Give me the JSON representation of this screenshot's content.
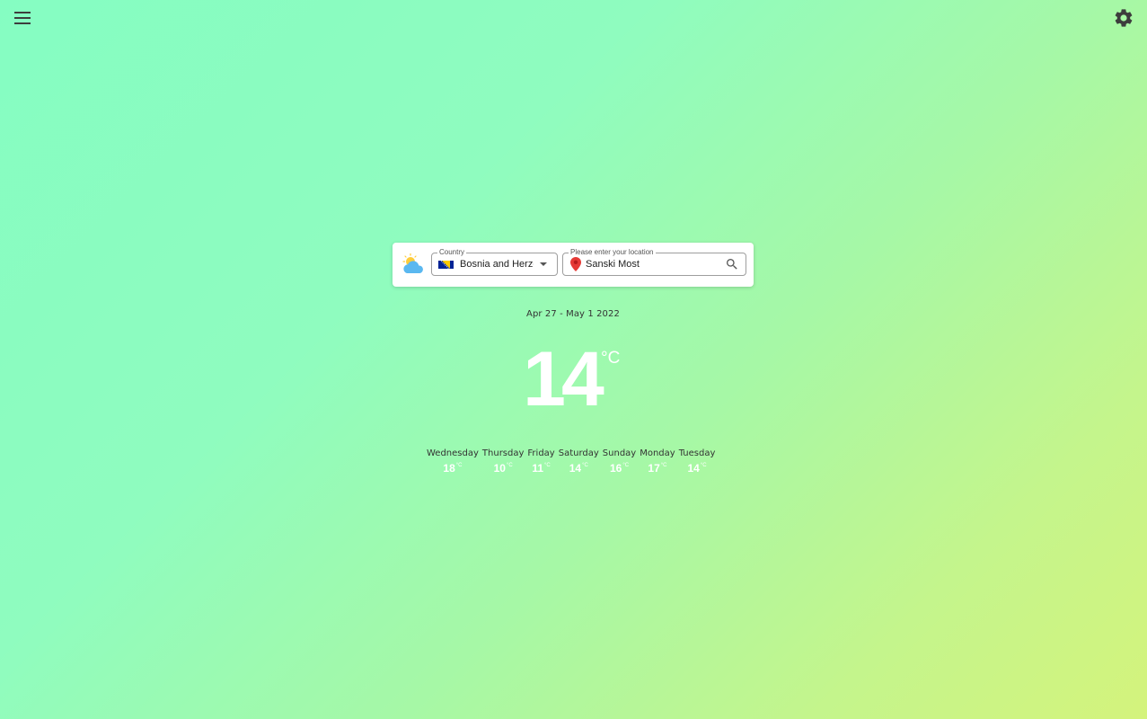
{
  "header": {
    "menu_icon": "hamburger-menu-icon",
    "settings_icon": "gear-icon",
    "icon_color": "#3d3d3d"
  },
  "search": {
    "weather_icon": "partly-cloudy-icon",
    "country_label": "Country",
    "country_value": "Bosnia and Herzegovina",
    "country_flag": "bosnia-and-herzegovina-flag",
    "location_label": "Please enter your location",
    "location_value": "Sanski Most",
    "pin_icon": "location-pin-icon",
    "search_icon": "search-icon"
  },
  "current": {
    "date_range": "Apr 27 - May 1 2022",
    "temperature": "14",
    "unit": "°C"
  },
  "forecast": [
    {
      "day": "Wednesday",
      "temp": "18",
      "unit": "°C"
    },
    {
      "day": "Thursday",
      "temp": "10",
      "unit": "°C"
    },
    {
      "day": "Friday",
      "temp": "11",
      "unit": "°C"
    },
    {
      "day": "Saturday",
      "temp": "14",
      "unit": "°C"
    },
    {
      "day": "Sunday",
      "temp": "16",
      "unit": "°C"
    },
    {
      "day": "Monday",
      "temp": "17",
      "unit": "°C"
    },
    {
      "day": "Tuesday",
      "temp": "14",
      "unit": "°C"
    }
  ],
  "colors": {
    "background_start": "#85fdc2",
    "background_end": "#d4f37c",
    "pin": "#e53935",
    "temperature_text": "#ffffff"
  }
}
